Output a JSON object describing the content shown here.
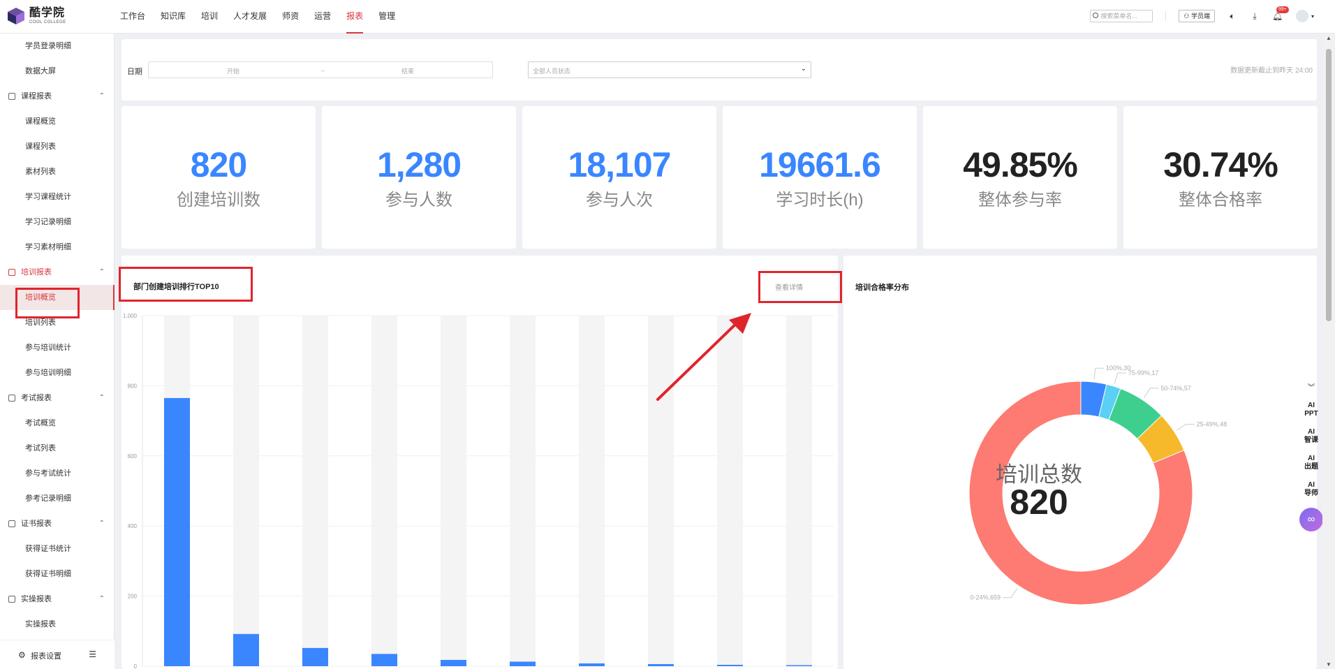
{
  "brand": {
    "name_cn": "酷学院",
    "name_en": "COOL COLLEGE"
  },
  "nav": {
    "items": [
      "工作台",
      "知识库",
      "培训",
      "人才发展",
      "师资",
      "运营",
      "报表",
      "管理"
    ],
    "active_index": 6
  },
  "topbar": {
    "search_placeholder": "搜索菜单名...",
    "student_button": "学员端",
    "notification_count": "99+"
  },
  "sidebar": {
    "entries": [
      {
        "kind": "item",
        "label": "学员登录明细"
      },
      {
        "kind": "item",
        "label": "数据大屏"
      },
      {
        "kind": "group",
        "label": "课程报表"
      },
      {
        "kind": "item",
        "label": "课程概览"
      },
      {
        "kind": "item",
        "label": "课程列表"
      },
      {
        "kind": "item",
        "label": "素材列表"
      },
      {
        "kind": "item",
        "label": "学习课程统计"
      },
      {
        "kind": "item",
        "label": "学习记录明细"
      },
      {
        "kind": "item",
        "label": "学习素材明细"
      },
      {
        "kind": "group",
        "label": "培训报表",
        "active": true
      },
      {
        "kind": "item",
        "label": "培训概览",
        "active": true
      },
      {
        "kind": "item",
        "label": "培训列表"
      },
      {
        "kind": "item",
        "label": "参与培训统计"
      },
      {
        "kind": "item",
        "label": "参与培训明细"
      },
      {
        "kind": "group",
        "label": "考试报表"
      },
      {
        "kind": "item",
        "label": "考试概览"
      },
      {
        "kind": "item",
        "label": "考试列表"
      },
      {
        "kind": "item",
        "label": "参与考试统计"
      },
      {
        "kind": "item",
        "label": "参考记录明细"
      },
      {
        "kind": "group",
        "label": "证书报表"
      },
      {
        "kind": "item",
        "label": "获得证书统计"
      },
      {
        "kind": "item",
        "label": "获得证书明细"
      },
      {
        "kind": "group",
        "label": "实操报表"
      },
      {
        "kind": "item",
        "label": "实操报表"
      }
    ],
    "footer_label": "报表设置"
  },
  "filter": {
    "date_label": "日期",
    "start_placeholder": "开始",
    "range_sep": "→",
    "end_placeholder": "结束",
    "status_placeholder": "全部人员状态",
    "updated_text": "数据更新截止到昨天 24:00"
  },
  "stats": [
    {
      "value": "820",
      "label": "创建培训数",
      "color": "#3a86ff"
    },
    {
      "value": "1,280",
      "label": "参与人数",
      "color": "#3a86ff"
    },
    {
      "value": "18,107",
      "label": "参与人次",
      "color": "#3a86ff"
    },
    {
      "value": "19661.6",
      "label": "学习时长(h)",
      "color": "#3a86ff"
    },
    {
      "value": "49.85%",
      "label": "整体参与率",
      "color": "#222222"
    },
    {
      "value": "30.74%",
      "label": "整体合格率",
      "color": "#222222"
    }
  ],
  "bar_panel": {
    "title": "部门创建培训排行TOP10",
    "detail_link": "查看详情"
  },
  "pie_panel": {
    "title": "培训合格率分布",
    "center_label": "培训总数",
    "center_value": "820"
  },
  "chart_data": [
    {
      "type": "bar",
      "title": "部门创建培训排行TOP10",
      "categories": [],
      "values": [
        765,
        92,
        52,
        35,
        18,
        13,
        8,
        6,
        4,
        3
      ],
      "ylim": [
        0,
        1000
      ],
      "yticks": [
        "0",
        "200",
        "400",
        "600",
        "800",
        "1,000"
      ],
      "grid": true,
      "bar_color": "#3a86ff",
      "background_bar_color": "#f4f4f4"
    },
    {
      "type": "pie",
      "title": "培训合格率分布",
      "donut": true,
      "slices": [
        {
          "label": "100%,30",
          "value": 30,
          "color": "#3a86ff"
        },
        {
          "label": "75-99%,17",
          "value": 17,
          "color": "#5ad0f5"
        },
        {
          "label": "50-74%,57",
          "value": 57,
          "color": "#3ecf8e"
        },
        {
          "label": "25-49%,48",
          "value": 48,
          "color": "#f6b92b"
        },
        {
          "label": "0-24%,659",
          "value": 659,
          "color": "#fd7b72"
        }
      ]
    }
  ],
  "float_tools": [
    "AI PPT",
    "AI 智课",
    "AI 出题",
    "AI 导师"
  ],
  "colors": {
    "accent": "#d9363e",
    "primary": "#3a86ff",
    "highlight": "#e0242c"
  }
}
